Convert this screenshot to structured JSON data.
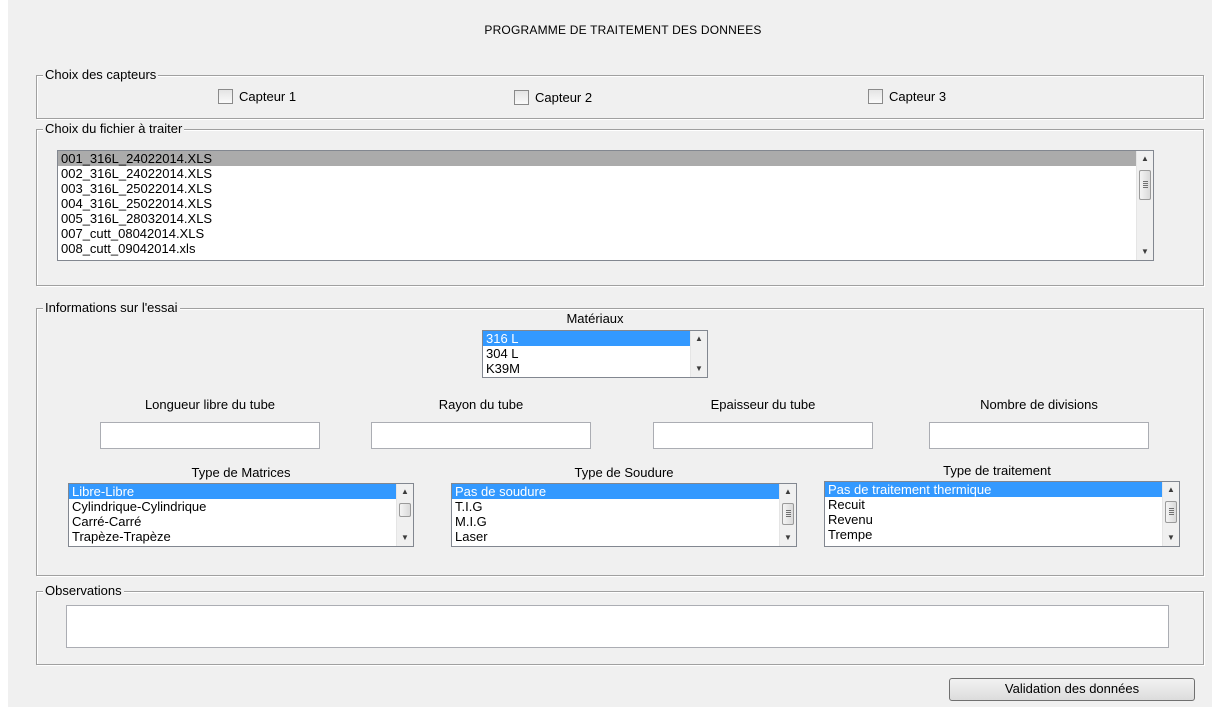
{
  "window": {
    "title": "PROGRAMME DE TRAITEMENT DES DONNEES"
  },
  "sensors": {
    "legend": "Choix des capteurs",
    "items": [
      {
        "label": "Capteur 1",
        "checked": false
      },
      {
        "label": "Capteur 2",
        "checked": false
      },
      {
        "label": "Capteur 3",
        "checked": false
      }
    ]
  },
  "file_choice": {
    "legend": "Choix du fichier à traiter",
    "files": [
      "001_316L_24022014.XLS",
      "002_316L_24022014.XLS",
      "003_316L_25022014.XLS",
      "004_316L_25022014.XLS",
      "005_316L_28032014.XLS",
      "007_cutt_08042014.XLS",
      "008_cutt_09042014.xls"
    ],
    "selected": "001_316L_24022014.XLS"
  },
  "test_info": {
    "legend": "Informations sur l'essai",
    "materials": {
      "label": "Matériaux",
      "options": [
        "316 L",
        "304 L",
        "K39M"
      ],
      "selected": "316 L"
    },
    "fields": {
      "length_label": "Longueur libre du tube",
      "radius_label": "Rayon du tube",
      "thickness_label": "Epaisseur du tube",
      "divisions_label": "Nombre de divisions",
      "length_value": "",
      "radius_value": "",
      "thickness_value": "",
      "divisions_value": ""
    },
    "matrix_type": {
      "label": "Type de Matrices",
      "options": [
        "Libre-Libre",
        "Cylindrique-Cylindrique",
        "Carré-Carré",
        "Trapèze-Trapèze"
      ],
      "selected": "Libre-Libre"
    },
    "weld_type": {
      "label": "Type de Soudure",
      "options": [
        "Pas de soudure",
        "T.I.G",
        "M.I.G",
        "Laser"
      ],
      "selected": "Pas de soudure"
    },
    "treatment_type": {
      "label": "Type de traitement",
      "options": [
        "Pas de traitement thermique",
        "Recuit",
        "Revenu",
        "Trempe"
      ],
      "selected": "Pas de traitement thermique"
    }
  },
  "observations": {
    "legend": "Observations",
    "value": ""
  },
  "actions": {
    "validate_label": "Validation des données"
  },
  "colors": {
    "selection_blue": "#3399ff",
    "selection_gray": "#ababab",
    "panel_bg": "#f0f0f0"
  }
}
